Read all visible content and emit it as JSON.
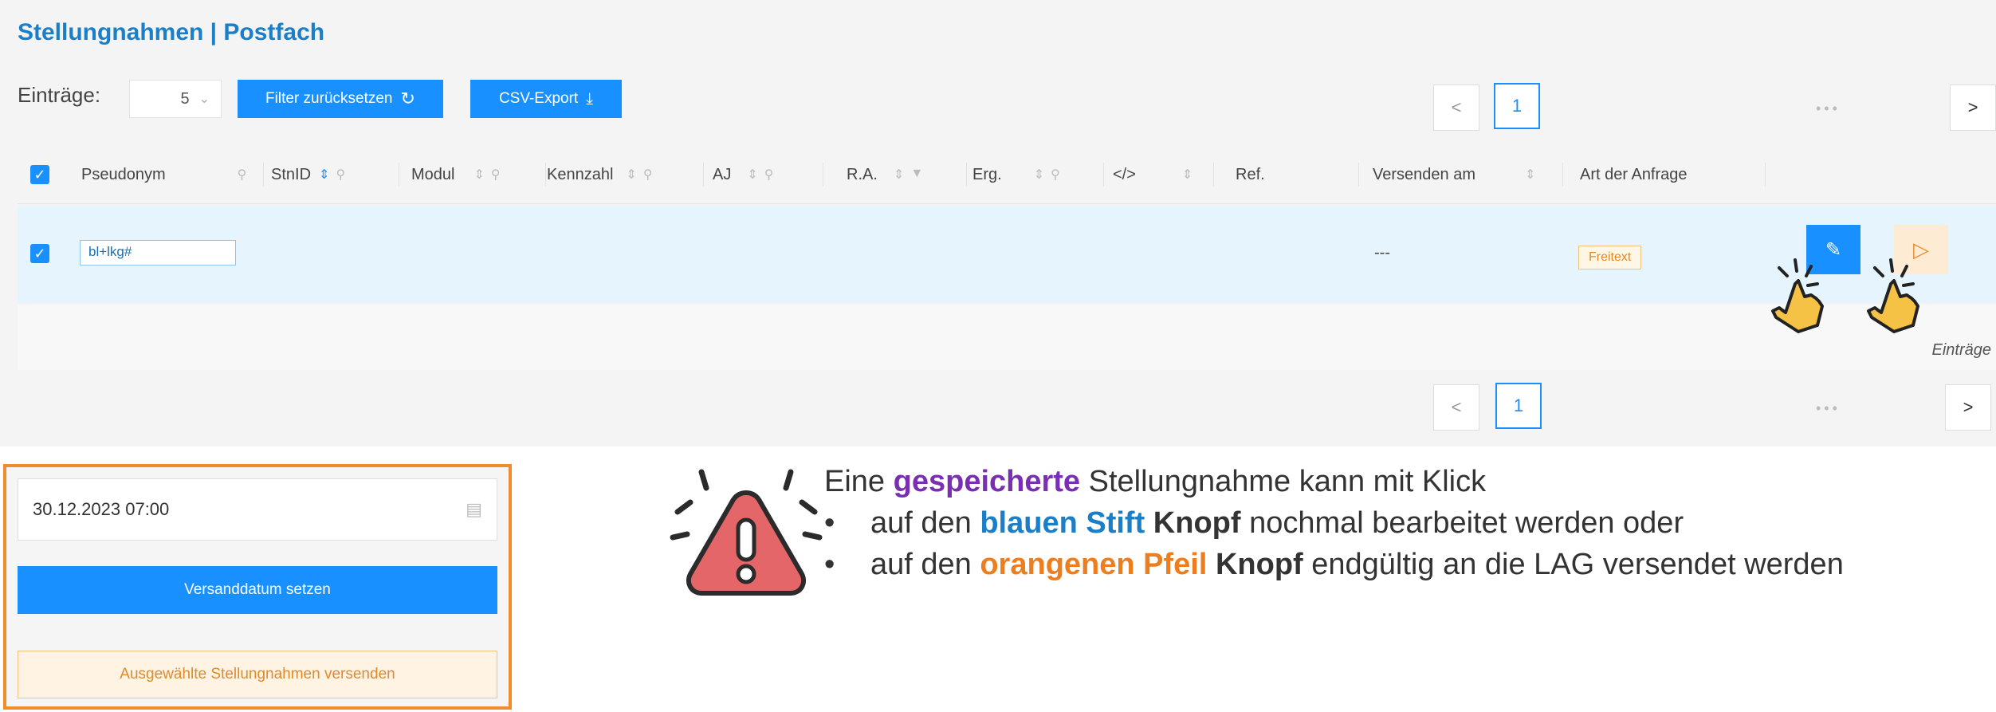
{
  "header": {
    "title": "Stellungnahmen | Postfach"
  },
  "toolbar": {
    "entries_label": "Einträge:",
    "page_size": "5",
    "reset_filter_label": "Filter zurücksetzen",
    "csv_export_label": "CSV-Export"
  },
  "pagination": {
    "prev": "<",
    "current": "1",
    "ellipsis": "•••",
    "next": ">"
  },
  "table": {
    "columns": [
      "Pseudonym",
      "StnID",
      "Modul",
      "Kennzahl",
      "AJ",
      "R.A.",
      "Erg.",
      "</>",
      "Ref.",
      "Versenden am",
      "Art der Anfrage"
    ],
    "row": {
      "pseudonym": "bl+lkg#",
      "versenden_am": "---",
      "art_der_anfrage": "Freitext",
      "edit_icon": "pencil-icon",
      "send_icon": "arrow-right-icon"
    },
    "footer_entries_label": "Einträge"
  },
  "send_panel": {
    "date_value": "30.12.2023 07:00",
    "set_date_label": "Versanddatum setzen",
    "send_selected_label": "Ausgewählte Stellungnahmen versenden"
  },
  "note": {
    "line1_pre": "Eine ",
    "line1_em": "gespeicherte",
    "line1_post": " Stellungnahme kann mit Klick",
    "bullet": "•",
    "b1_pre": "auf den ",
    "b1_color": "blauen Stift",
    "b1_bold": "Knopf",
    "b1_post": " nochmal bearbeitet werden oder",
    "b2_pre": "auf den ",
    "b2_color": "orangenen Pfeil",
    "b2_bold": "Knopf",
    "b2_post": " endgültig an die LAG versendet werden"
  },
  "colors": {
    "primary": "#1890ff",
    "accent_orange": "#f08c2d",
    "title_blue": "#1a7ec8",
    "highlight_purple": "#7a2fb3"
  }
}
